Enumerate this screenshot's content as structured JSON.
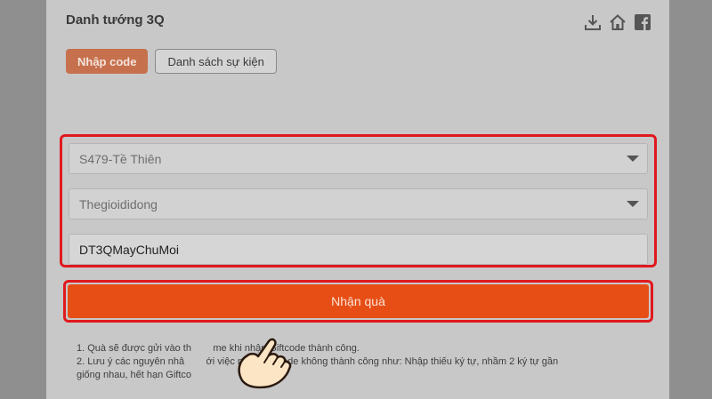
{
  "header": {
    "title": "Danh tướng 3Q"
  },
  "icons": {
    "download": "download-icon",
    "home": "home-icon",
    "facebook": "facebook-icon"
  },
  "tabs": [
    {
      "label": "Nhập code",
      "active": true
    },
    {
      "label": "Danh sách sự kiện",
      "active": false
    }
  ],
  "form": {
    "server": {
      "value": "S479-Tề Thiên"
    },
    "character": {
      "value": "Thegioididong"
    },
    "giftcode": {
      "value": "DT3QMayChuMoi"
    }
  },
  "submit_label": "Nhận quà",
  "notes": [
    "1. Quà sẽ được gửi vào th        me khi nhập Giftcode thành công.",
    "2. Lưu ý các nguyên nhâ        ới việc nhập Giftcode không thành công như: Nhập thiếu ký tự, nhầm 2 ký tự gần",
    "giống nhau, hết hạn Giftco"
  ],
  "colors": {
    "accent": "#e74e16",
    "highlight": "#e0191e",
    "tab_active": "#c7704e"
  }
}
